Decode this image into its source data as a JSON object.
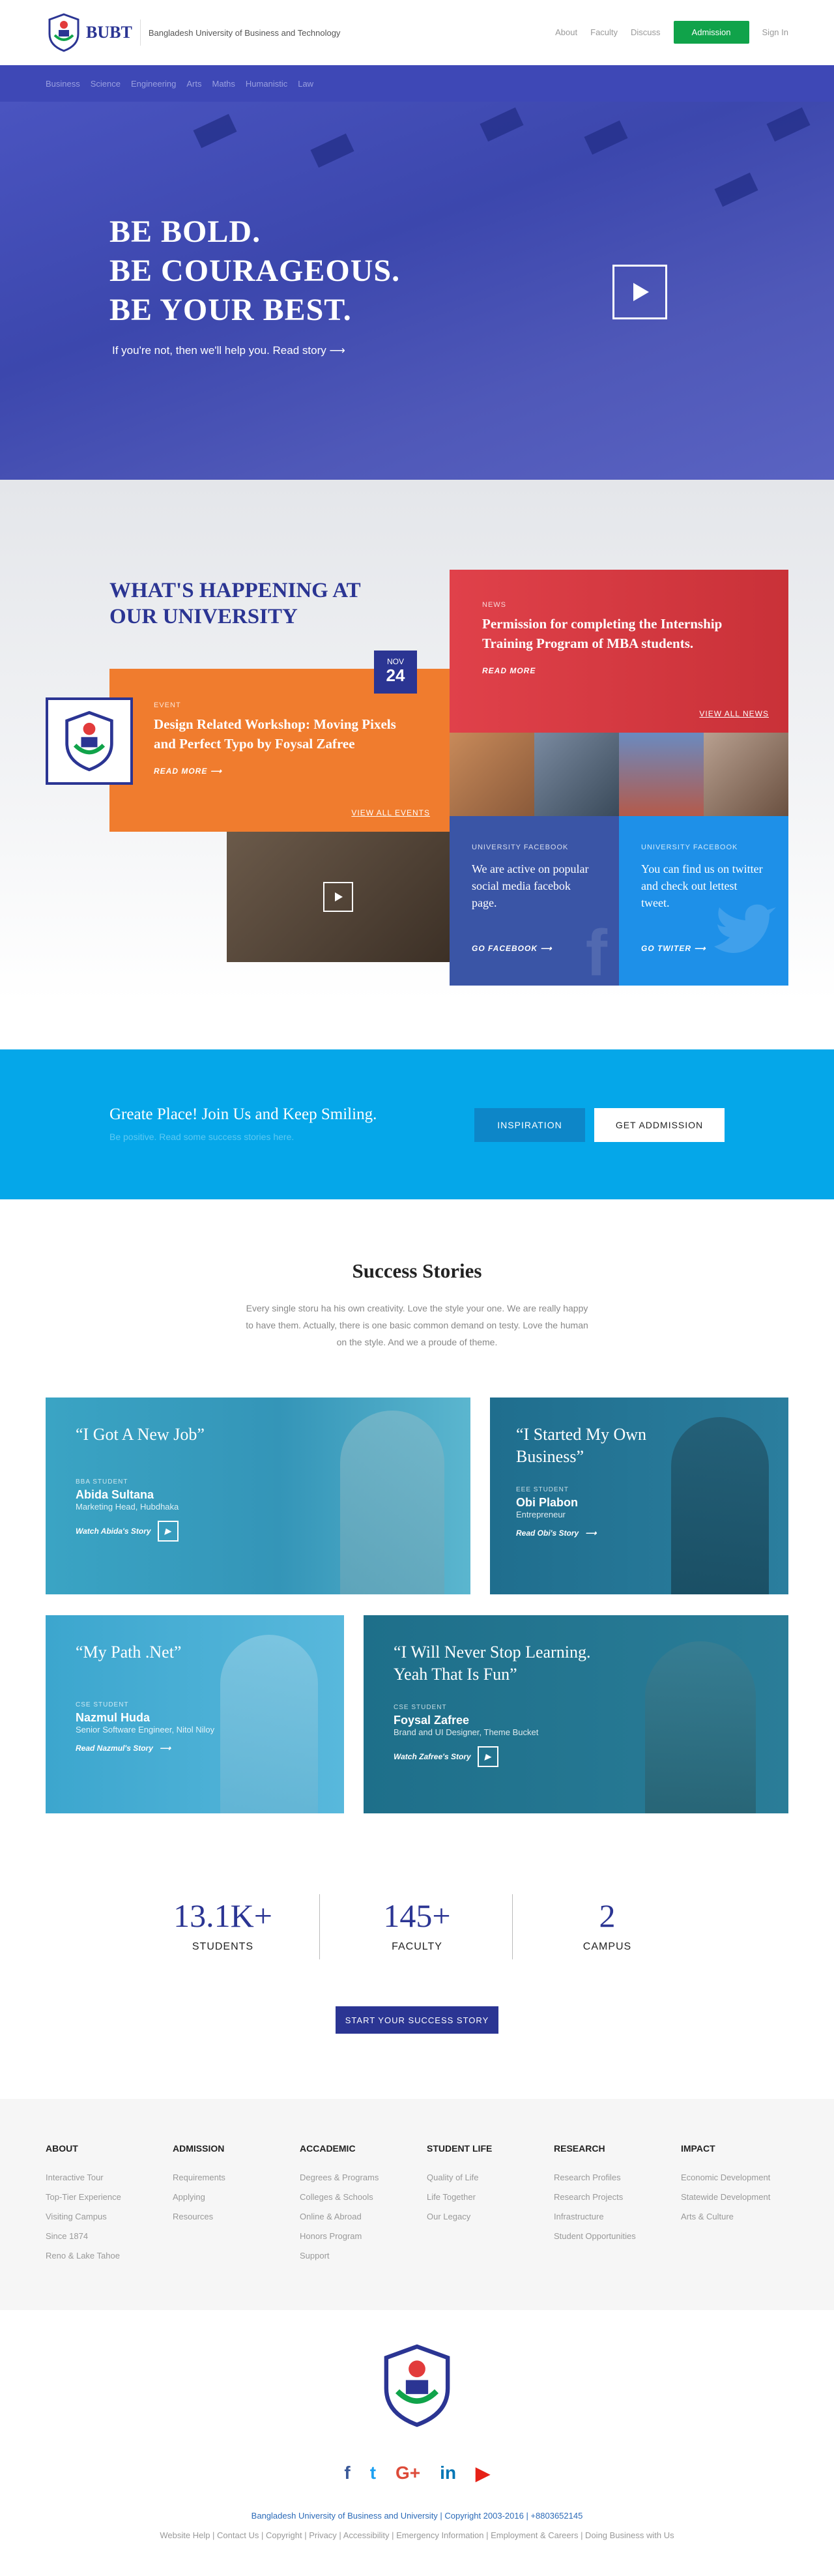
{
  "header": {
    "brand": "BUBT",
    "brand_full": "Bangladesh University of Business and Technology",
    "nav": [
      "About",
      "Faculty",
      "Discuss"
    ],
    "admission": "Admission",
    "signin": "Sign In"
  },
  "subnav": [
    "Business",
    "Science",
    "Engineering",
    "Arts",
    "Maths",
    "Humanistic",
    "Law"
  ],
  "hero": {
    "line1": "BE BOLD.",
    "line2": "BE COURAGEOUS.",
    "line3": "BE YOUR BEST.",
    "link": "If you're not, then we'll help you. Read story"
  },
  "happening": {
    "title_line1": "WHAT'S HAPPENING AT",
    "title_line2": "OUR UNIVERSITY",
    "event": {
      "kicker": "EVENT",
      "headline": "Design Related Workshop: Moving Pixels and Perfect Typo by Foysal Zafree",
      "more": "READ MORE",
      "view_all": "VIEW ALL EVENTS",
      "month": "NOV",
      "day": "24"
    },
    "news": {
      "kicker": "NEWS",
      "headline": "Permission for completing the Internship Training Program of MBA students.",
      "more": "READ MORE",
      "view_all": "VIEW ALL NEWS"
    },
    "facebook": {
      "kicker": "UNIVERSITY FACEBOOK",
      "text": "We are active on popular social media facebok page.",
      "link": "GO FACEBOOK"
    },
    "twitter": {
      "kicker": "UNIVERSITY FACEBOOK",
      "text": "You can find us on twitter and check out lettest tweet.",
      "link": "GO TWITER"
    }
  },
  "cta": {
    "title": "Greate Place! Join Us and Keep Smiling.",
    "subtitle": "Be positive. Read some success stories here.",
    "inspiration": "INSPIRATION",
    "get_admission": "GET ADDMISSION"
  },
  "success": {
    "title": "Success Stories",
    "desc": "Every single storu ha his own creativity. Love the style your one. We are really happy to have them. Actually, there is one basic common demand on testy. Love the human on the style. And we a proude of theme.",
    "stories": [
      {
        "quote": "“I Got A New Job”",
        "role": "BBA STUDENT",
        "name": "Abida Sultana",
        "title": "Marketing Head, Hubdhaka",
        "watch": "Watch Abida's Story"
      },
      {
        "quote": "“I Started My Own Business”",
        "role": "EEE STUDENT",
        "name": "Obi Plabon",
        "title": "Entrepreneur",
        "watch": "Read Obi's Story"
      },
      {
        "quote": "“My Path .Net”",
        "role": "CSE STUDENT",
        "name": "Nazmul Huda",
        "title": "Senior Software Engineer, Nitol Niloy",
        "watch": "Read Nazmul's Story"
      },
      {
        "quote": "“I Will Never Stop Learning. Yeah That Is Fun”",
        "role": "CSE STUDENT",
        "name": "Foysal Zafree",
        "title": "Brand and UI Designer, Theme Bucket",
        "watch": "Watch Zafree's Story"
      }
    ]
  },
  "stats": [
    {
      "value": "13.1K+",
      "label": "STUDENTS"
    },
    {
      "value": "145+",
      "label": "FACULTY"
    },
    {
      "value": "2",
      "label": "CAMPUS"
    }
  ],
  "start_button": "START YOUR SUCCESS STORY",
  "footer": {
    "columns": [
      {
        "title": "ABOUT",
        "items": [
          "Interactive Tour",
          "Top-Tier Experience",
          "Visiting Campus",
          "Since 1874",
          "Reno & Lake Tahoe"
        ]
      },
      {
        "title": "ADMISSION",
        "items": [
          "Requirements",
          "Applying",
          "Resources"
        ]
      },
      {
        "title": "ACCADEMIC",
        "items": [
          "Degrees & Programs",
          "Colleges & Schools",
          "Online & Abroad",
          "Honors Program",
          "Support"
        ]
      },
      {
        "title": "STUDENT LIFE",
        "items": [
          "Quality of Life",
          "Life Together",
          "Our Legacy"
        ]
      },
      {
        "title": "RESEARCH",
        "items": [
          "Research Profiles",
          "Research Projects",
          "Infrastructure",
          "Student Opportunities"
        ]
      },
      {
        "title": "IMPACT",
        "items": [
          "Economic Development",
          "Statewide Development",
          "Arts & Culture"
        ]
      }
    ],
    "copyright": "Bangladesh University of Business and University | Copyright 2003-2016 | +8803652145",
    "legal": "Website Help | Contact Us | Copyright | Privacy | Accessibility | Emergency Information | Employment & Careers | Doing Business with Us"
  },
  "social": [
    {
      "icon": "facebook-icon",
      "glyph": "f",
      "color": "#3b5998"
    },
    {
      "icon": "twitter-icon",
      "glyph": "t",
      "color": "#1da1f2"
    },
    {
      "icon": "google-plus-icon",
      "glyph": "G+",
      "color": "#dd4b39"
    },
    {
      "icon": "linkedin-icon",
      "glyph": "in",
      "color": "#0077b5"
    },
    {
      "icon": "youtube-icon",
      "glyph": "▶",
      "color": "#e62117"
    }
  ],
  "colors": {
    "brand": "#2b3593",
    "accent": "#10a34a",
    "event": "#f07c2e",
    "news": "#d63a42",
    "facebook": "#3a55a6",
    "twitter": "#1e90e8",
    "cta": "#05a7e9"
  }
}
